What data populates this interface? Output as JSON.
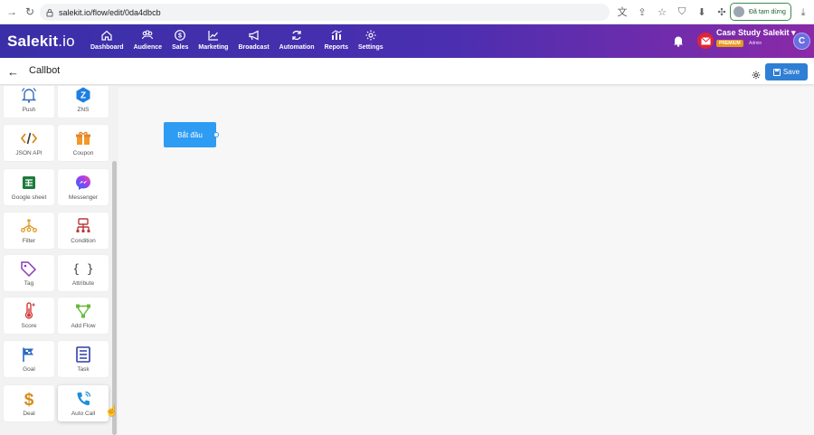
{
  "browser": {
    "url": "salekit.io/flow/edit/0da4dbcb",
    "paused_label": "Đã tạm dừng"
  },
  "app": {
    "logo": "Salekit",
    "logo_suffix": ".io",
    "menu": [
      {
        "label": "Dashboard",
        "icon": "home-icon"
      },
      {
        "label": "Audience",
        "icon": "people-icon"
      },
      {
        "label": "Sales",
        "icon": "dollar-icon"
      },
      {
        "label": "Marketing",
        "icon": "chart-line-icon"
      },
      {
        "label": "Broadcast",
        "icon": "megaphone-icon"
      },
      {
        "label": "Automation",
        "icon": "refresh-icon"
      },
      {
        "label": "Reports",
        "icon": "bar-chart-icon"
      },
      {
        "label": "Settings",
        "icon": "gear-icon"
      }
    ],
    "account": {
      "name": "Case Study Salekit",
      "badge": "PREMIUM",
      "role": "Admin",
      "avatar_letter": "C"
    }
  },
  "page": {
    "title": "Callbot",
    "save_label": "Save"
  },
  "palette": [
    {
      "label": "Push",
      "icon": "bell-icon"
    },
    {
      "label": "ZNS",
      "icon": "zalo-icon"
    },
    {
      "label": "JSON API",
      "icon": "code-icon"
    },
    {
      "label": "Coupon",
      "icon": "gift-icon"
    },
    {
      "label": "Google sheet",
      "icon": "sheet-icon"
    },
    {
      "label": "Messenger",
      "icon": "messenger-icon"
    },
    {
      "label": "Filter",
      "icon": "filter-icon"
    },
    {
      "label": "Condition",
      "icon": "condition-icon"
    },
    {
      "label": "Tag",
      "icon": "tag-icon"
    },
    {
      "label": "Attribute",
      "icon": "braces-icon"
    },
    {
      "label": "Score",
      "icon": "thermometer-icon"
    },
    {
      "label": "Add Flow",
      "icon": "flow-icon"
    },
    {
      "label": "Goal",
      "icon": "flag-icon"
    },
    {
      "label": "Task",
      "icon": "task-icon"
    },
    {
      "label": "Deal",
      "icon": "dollar-sign-icon"
    },
    {
      "label": "Auto Call",
      "icon": "phone-icon"
    }
  ],
  "canvas": {
    "start_node": "Bắt đầu"
  },
  "colors": {
    "header_start": "#3a2fa8",
    "header_end": "#8a2aa8",
    "primary": "#2e9cf2",
    "save": "#2f7fd4"
  }
}
